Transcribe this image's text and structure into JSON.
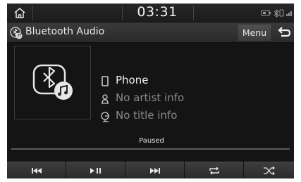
{
  "status_bar": {
    "time": "03:31",
    "icons": [
      "home-icon",
      "battery-icon",
      "bluetooth-phone-icon",
      "signal-icon"
    ]
  },
  "title_bar": {
    "title": "Bluetooth Audio",
    "menu_label": "Menu",
    "icons": [
      "bluetooth-audio-icon",
      "back-arrow-icon"
    ]
  },
  "track_info": {
    "device": "Phone",
    "artist": "No artist info",
    "title": "No title info",
    "icons": [
      "phone-icon",
      "person-icon",
      "music-title-icon"
    ]
  },
  "playback": {
    "state": "Paused"
  },
  "controls": [
    {
      "name": "previous-track",
      "icon": "skip-previous-icon"
    },
    {
      "name": "play-pause",
      "icon": "play-pause-icon"
    },
    {
      "name": "next-track",
      "icon": "skip-next-icon"
    },
    {
      "name": "repeat",
      "icon": "repeat-icon"
    },
    {
      "name": "shuffle",
      "icon": "shuffle-icon"
    }
  ],
  "colors": {
    "background": "#141414",
    "text_primary": "#f0f0f0",
    "text_secondary": "#8a8a8a"
  }
}
